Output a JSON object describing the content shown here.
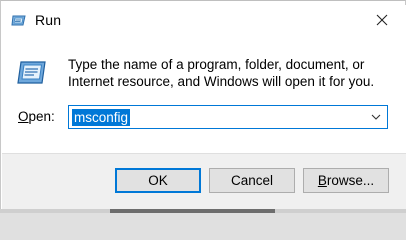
{
  "window": {
    "title": "Run",
    "title_icon": "run-dialog-icon",
    "close_icon": "close-icon"
  },
  "content": {
    "icon": "run-dialog-icon",
    "description": "Type the name of a program, folder, document, or Internet resource, and Windows will open it for you.",
    "open_label_accel": "O",
    "open_label_rest": "pen:",
    "open_value": "msconfig",
    "dropdown_icon": "chevron-down-icon"
  },
  "buttons": {
    "ok": "OK",
    "cancel": "Cancel",
    "browse_accel": "B",
    "browse_rest": "rowse..."
  },
  "colors": {
    "accent": "#0078d7",
    "footer_bg": "#f0f0f0",
    "button_bg": "#e1e1e1"
  }
}
